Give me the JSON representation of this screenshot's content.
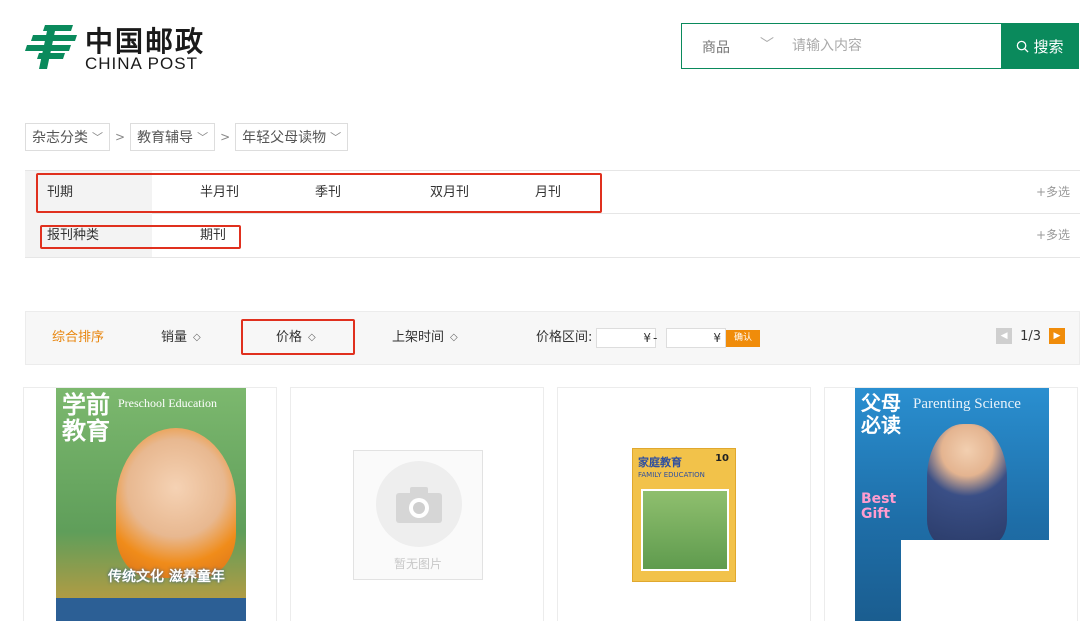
{
  "header": {
    "logo_cn": "中国邮政",
    "logo_en": "CHINA POST",
    "search": {
      "category": "商品",
      "placeholder": "请输入内容",
      "button_label": "搜索"
    }
  },
  "breadcrumb": [
    {
      "label": "杂志分类"
    },
    {
      "label": "教育辅导"
    },
    {
      "label": "年轻父母读物"
    }
  ],
  "filters": {
    "period": {
      "label": "刊期",
      "options": [
        "半月刊",
        "季刊",
        "双月刊",
        "月刊"
      ],
      "more": "+多选"
    },
    "type": {
      "label": "报刊种类",
      "options": [
        "期刊"
      ],
      "more": "+多选"
    }
  },
  "sortbar": {
    "default": "综合排序",
    "sales": "销量",
    "price": "价格",
    "listing_time": "上架时间",
    "price_range_label": "价格区间:",
    "currency": "¥",
    "dash": "-",
    "confirm": "确认",
    "page": "1/3"
  },
  "products": [
    {
      "title_cn": "学前教育",
      "title_en": "Preschool Education",
      "slogan": "传统文化 滋养童年",
      "colors": {
        "bg": "#6aa86a",
        "accent": "#f08c1a"
      }
    },
    {
      "placeholder_text": "暂无图片"
    },
    {
      "title_cn": "家庭教育",
      "title_en": "FAMILY EDUCATION",
      "issue": "10",
      "colors": {
        "bg": "#f2c24a"
      }
    },
    {
      "title_cn": "父母必读",
      "title_en": "Parenting Science",
      "badge_en": "Best Gift",
      "colors": {
        "bg": "#1e7ab8"
      }
    }
  ],
  "colors": {
    "brand_green": "#0a8a5c",
    "accent_orange": "#f08c0a",
    "highlight_red": "#e0301e"
  }
}
